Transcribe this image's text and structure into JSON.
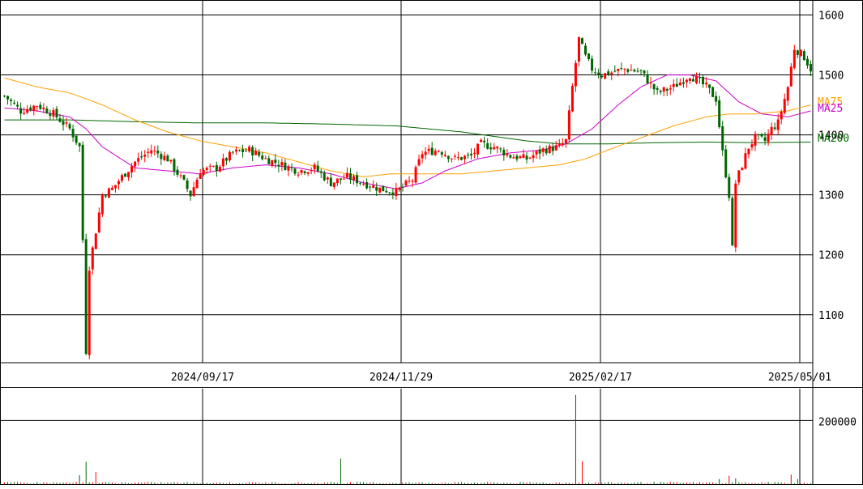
{
  "chart_data": {
    "type": "candlestick",
    "price_axis": {
      "ylim": [
        1020,
        1625
      ],
      "ticks": [
        1100,
        1200,
        1300,
        1400,
        1500,
        1600
      ]
    },
    "volume_axis": {
      "ylim": [
        0,
        300000
      ],
      "ticks": [
        200000
      ]
    },
    "date_labels": [
      "2024/09/17",
      "2024/11/29",
      "2025/02/17",
      "2025/05/01"
    ],
    "date_label_bar_index": [
      61,
      122,
      183,
      244
    ],
    "bar_count": 248,
    "colors": {
      "up": "#ff0000",
      "down": "#006600",
      "ma25": "#cc00cc",
      "ma75": "#ffa000",
      "ma200": "#006600"
    },
    "legend": [
      {
        "name": "MA75",
        "color": "#ffa000"
      },
      {
        "name": "MA25",
        "color": "#cc00cc"
      },
      {
        "name": "MA200",
        "color": "#006600"
      }
    ],
    "price_anchors": [
      [
        0,
        1465
      ],
      [
        5,
        1440
      ],
      [
        10,
        1450
      ],
      [
        15,
        1435
      ],
      [
        20,
        1410
      ],
      [
        23,
        1380
      ],
      [
        24,
        1225
      ],
      [
        25,
        1040
      ],
      [
        26,
        1180
      ],
      [
        28,
        1240
      ],
      [
        30,
        1300
      ],
      [
        33,
        1310
      ],
      [
        36,
        1330
      ],
      [
        40,
        1355
      ],
      [
        45,
        1375
      ],
      [
        50,
        1360
      ],
      [
        55,
        1320
      ],
      [
        57,
        1300
      ],
      [
        60,
        1340
      ],
      [
        65,
        1345
      ],
      [
        70,
        1370
      ],
      [
        75,
        1375
      ],
      [
        80,
        1360
      ],
      [
        85,
        1350
      ],
      [
        90,
        1340
      ],
      [
        95,
        1345
      ],
      [
        100,
        1320
      ],
      [
        105,
        1330
      ],
      [
        110,
        1320
      ],
      [
        115,
        1310
      ],
      [
        120,
        1305
      ],
      [
        125,
        1325
      ],
      [
        128,
        1370
      ],
      [
        133,
        1375
      ],
      [
        138,
        1360
      ],
      [
        143,
        1365
      ],
      [
        146,
        1385
      ],
      [
        150,
        1380
      ],
      [
        155,
        1365
      ],
      [
        160,
        1360
      ],
      [
        165,
        1375
      ],
      [
        170,
        1380
      ],
      [
        172,
        1390
      ],
      [
        174,
        1480
      ],
      [
        176,
        1560
      ],
      [
        178,
        1530
      ],
      [
        180,
        1510
      ],
      [
        183,
        1500
      ],
      [
        190,
        1510
      ],
      [
        195,
        1505
      ],
      [
        200,
        1470
      ],
      [
        205,
        1480
      ],
      [
        210,
        1500
      ],
      [
        215,
        1480
      ],
      [
        218,
        1460
      ],
      [
        220,
        1370
      ],
      [
        222,
        1300
      ],
      [
        223,
        1210
      ],
      [
        224,
        1320
      ],
      [
        226,
        1350
      ],
      [
        228,
        1380
      ],
      [
        230,
        1395
      ],
      [
        233,
        1390
      ],
      [
        235,
        1410
      ],
      [
        237,
        1420
      ],
      [
        240,
        1480
      ],
      [
        242,
        1545
      ],
      [
        245,
        1530
      ],
      [
        247,
        1510
      ]
    ],
    "ma25_anchors": [
      [
        0,
        1445
      ],
      [
        10,
        1440
      ],
      [
        20,
        1430
      ],
      [
        25,
        1410
      ],
      [
        30,
        1380
      ],
      [
        40,
        1345
      ],
      [
        50,
        1340
      ],
      [
        60,
        1335
      ],
      [
        70,
        1345
      ],
      [
        80,
        1350
      ],
      [
        90,
        1345
      ],
      [
        100,
        1335
      ],
      [
        110,
        1320
      ],
      [
        120,
        1310
      ],
      [
        128,
        1320
      ],
      [
        135,
        1340
      ],
      [
        145,
        1360
      ],
      [
        155,
        1370
      ],
      [
        165,
        1375
      ],
      [
        172,
        1385
      ],
      [
        180,
        1410
      ],
      [
        188,
        1450
      ],
      [
        195,
        1480
      ],
      [
        203,
        1500
      ],
      [
        210,
        1500
      ],
      [
        218,
        1490
      ],
      [
        225,
        1455
      ],
      [
        232,
        1435
      ],
      [
        240,
        1430
      ],
      [
        247,
        1440
      ]
    ],
    "ma75_anchors": [
      [
        0,
        1495
      ],
      [
        10,
        1480
      ],
      [
        20,
        1470
      ],
      [
        30,
        1450
      ],
      [
        40,
        1425
      ],
      [
        50,
        1405
      ],
      [
        60,
        1390
      ],
      [
        70,
        1380
      ],
      [
        80,
        1370
      ],
      [
        90,
        1355
      ],
      [
        100,
        1340
      ],
      [
        110,
        1330
      ],
      [
        118,
        1335
      ],
      [
        130,
        1335
      ],
      [
        140,
        1335
      ],
      [
        150,
        1340
      ],
      [
        160,
        1345
      ],
      [
        170,
        1350
      ],
      [
        178,
        1360
      ],
      [
        185,
        1375
      ],
      [
        195,
        1395
      ],
      [
        205,
        1415
      ],
      [
        215,
        1430
      ],
      [
        222,
        1435
      ],
      [
        230,
        1435
      ],
      [
        240,
        1440
      ],
      [
        247,
        1450
      ]
    ],
    "ma200_anchors": [
      [
        0,
        1425
      ],
      [
        20,
        1425
      ],
      [
        40,
        1422
      ],
      [
        60,
        1420
      ],
      [
        80,
        1420
      ],
      [
        100,
        1418
      ],
      [
        120,
        1415
      ],
      [
        140,
        1405
      ],
      [
        160,
        1390
      ],
      [
        170,
        1385
      ],
      [
        185,
        1385
      ],
      [
        200,
        1387
      ],
      [
        215,
        1388
      ],
      [
        230,
        1387
      ],
      [
        247,
        1388
      ]
    ],
    "volume_spikes": [
      [
        23,
        28000
      ],
      [
        25,
        70000
      ],
      [
        28,
        38000
      ],
      [
        103,
        80000
      ],
      [
        175,
        280000
      ],
      [
        177,
        72000
      ],
      [
        219,
        16000
      ],
      [
        222,
        26000
      ],
      [
        224,
        18000
      ],
      [
        241,
        30000
      ],
      [
        243,
        16000
      ]
    ]
  }
}
